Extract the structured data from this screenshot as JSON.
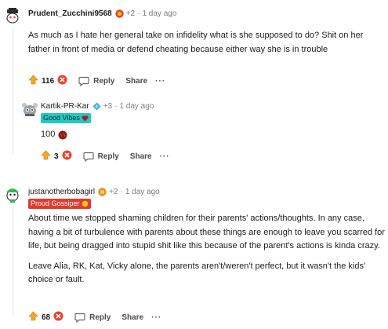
{
  "comments": [
    {
      "username": "Prudent_Zucchini9568",
      "karma": "+2",
      "time": "1 day ago",
      "body": [
        "As much as I hate her general take on infidelity what is she supposed to do? Shit on her father in front of media or defend cheating because either way she is in trouble"
      ],
      "votes": "116",
      "reply_label": "Reply",
      "share_label": "Share"
    },
    {
      "username": "Kartik-PR-Kar",
      "karma": "+3",
      "time": "1 day ago",
      "flair": "Good Vibes",
      "body": [
        "100"
      ],
      "votes": "3",
      "reply_label": "Reply",
      "share_label": "Share"
    },
    {
      "username": "justanotherbobagirl",
      "karma": "+2",
      "time": "1 day ago",
      "flair": "Proud Gossiper",
      "body": [
        "About time we stopped shaming children for their parents' actions/thoughts. In any case, having a bit of turbulence with parents about these things are enough to leave you scarred for life, but being dragged into stupid shit like this because of the parent's actions is kinda crazy.",
        "Leave Alia, RK, Kat, Vicky alone, the parents aren't/weren't perfect, but it wasn't the kids' choice or fault."
      ],
      "votes": "68",
      "reply_label": "Reply",
      "share_label": "Share"
    }
  ],
  "colors": {
    "upvote": "#f5a623",
    "downvote": "#e8432b",
    "flair_teal": "#23c9c1",
    "flair_red": "#e03a2f"
  }
}
